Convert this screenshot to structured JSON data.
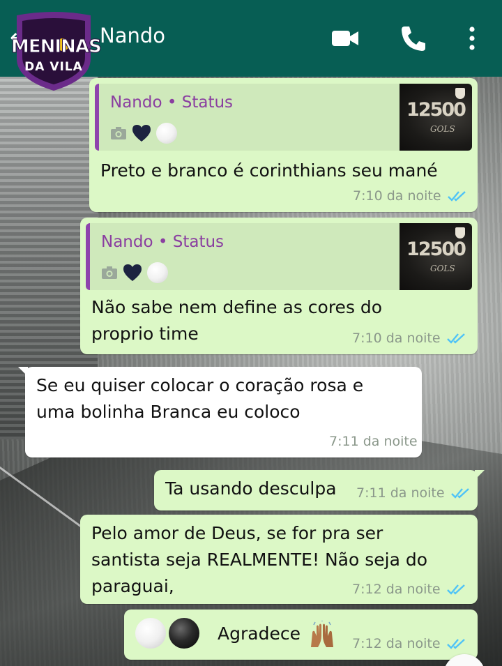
{
  "header": {
    "contact_name": "Nando",
    "badge_line1": "MENINAS",
    "badge_line2": "DA VILA",
    "icons": [
      "back-arrow-icon",
      "video-call-icon",
      "phone-icon",
      "more-options-icon"
    ]
  },
  "colors": {
    "header": "#075e54",
    "outgoing_bubble": "#dcf8c6",
    "incoming_bubble": "#ffffff",
    "quote_name": "#8a3ea0",
    "read_ticks": "#4fc3f7",
    "badge": "#6b2b8a"
  },
  "messages": [
    {
      "direction": "outgoing",
      "quote": {
        "name": "Nando • Status",
        "thumb_title": "12500",
        "thumb_sub": "GOLS"
      },
      "text": "Preto e branco é corinthians seu mané",
      "time": "7:10 da noite",
      "status": "read"
    },
    {
      "direction": "outgoing",
      "quote": {
        "name": "Nando • Status",
        "thumb_title": "12500",
        "thumb_sub": "GOLS"
      },
      "text_line1": "Não sabe nem define as cores do",
      "text_line2": "proprio time",
      "time": "7:10 da noite",
      "status": "read"
    },
    {
      "direction": "incoming",
      "text_line1": "Se eu quiser colocar o coração rosa e",
      "text_line2": "uma bolinha Branca eu coloco",
      "time": "7:11 da noite"
    },
    {
      "direction": "outgoing",
      "text": "Ta usando desculpa",
      "time": "7:11 da noite",
      "status": "read"
    },
    {
      "direction": "outgoing",
      "text_line1": "Pelo amor de Deus, se for pra ser",
      "text_line2": "santista seja REALMENTE! Não seja do",
      "text_line3": "paraguai,",
      "time": "7:12 da noite",
      "status": "read"
    },
    {
      "direction": "outgoing",
      "text": "Agradece",
      "emojis": [
        "white-circle",
        "black-circle",
        "raising-hands"
      ],
      "time": "7:12 da noite",
      "status": "read"
    }
  ]
}
